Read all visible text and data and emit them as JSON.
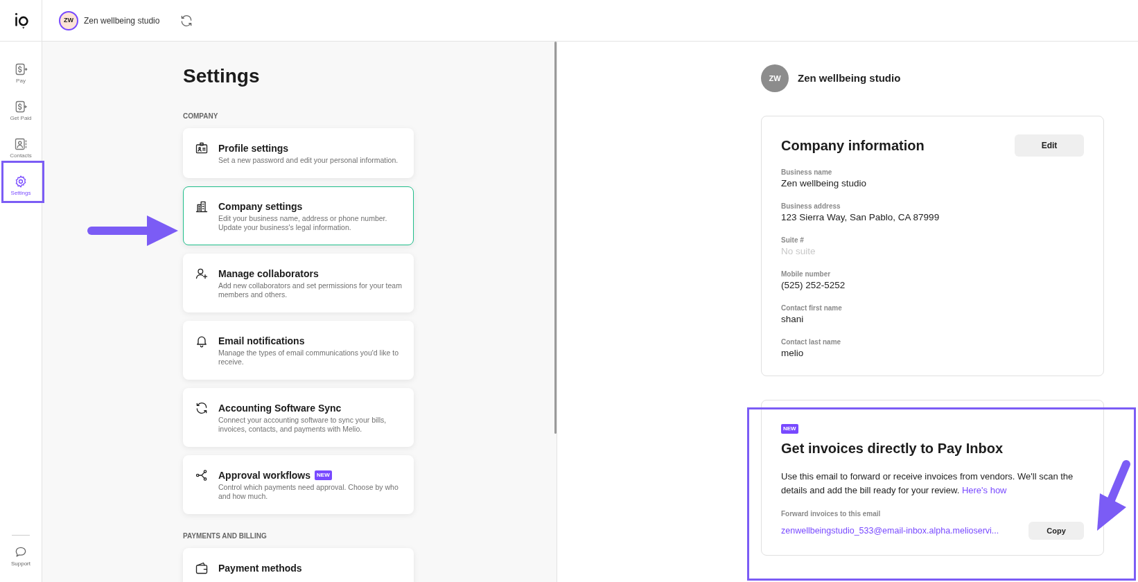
{
  "top_bar": {
    "avatar_initials": "ZW",
    "company_name": "Zen wellbeing studio"
  },
  "nav": [
    {
      "label": "Pay",
      "selected": false
    },
    {
      "label": "Get Paid",
      "selected": false
    },
    {
      "label": "Contacts",
      "selected": false
    },
    {
      "label": "Settings",
      "selected": true
    }
  ],
  "support": {
    "label": "Support"
  },
  "settings": {
    "title": "Settings",
    "sections": [
      {
        "heading": "COMPANY",
        "items": [
          {
            "title": "Profile settings",
            "description": "Set a new password and edit your personal information.",
            "selected": false
          },
          {
            "title": "Company settings",
            "description": "Edit your business name, address or phone number. Update your business's legal information.",
            "selected": true
          },
          {
            "title": "Manage collaborators",
            "description": "Add new collaborators and set permissions for your team members and others.",
            "selected": false
          },
          {
            "title": "Email notifications",
            "description": "Manage the types of email communications you'd like to receive.",
            "selected": false
          },
          {
            "title": "Accounting Software Sync",
            "description": "Connect your accounting software to sync your bills, invoices, contacts, and payments with Melio.",
            "selected": false
          },
          {
            "title": "Approval workflows",
            "badge": "NEW",
            "description": "Control which payments need approval. Choose by who and how much.",
            "selected": false
          }
        ]
      },
      {
        "heading": "PAYMENTS AND BILLING",
        "items": [
          {
            "title": "Payment methods",
            "selected": false
          }
        ]
      }
    ]
  },
  "company_header": {
    "avatar_initials": "ZW",
    "name": "Zen wellbeing studio"
  },
  "company_info": {
    "title": "Company information",
    "edit_button": "Edit",
    "fields": [
      {
        "label": "Business name",
        "value": "Zen wellbeing studio",
        "empty": false
      },
      {
        "label": "Business address",
        "value": "123 Sierra Way, San Pablo, CA 87999",
        "empty": false
      },
      {
        "label": "Suite #",
        "value": "No suite",
        "empty": true
      },
      {
        "label": "Mobile number",
        "value": "(525) 252-5252",
        "empty": false
      },
      {
        "label": "Contact first name",
        "value": "shani",
        "empty": false
      },
      {
        "label": "Contact last name",
        "value": "melio",
        "empty": false
      }
    ]
  },
  "inbox_card": {
    "badge": "NEW",
    "title": "Get invoices directly to Pay Inbox",
    "description": "Use this email to forward or receive invoices from vendors. We'll scan the details and add the bill ready for your review.",
    "link": "Here's how",
    "email_label": "Forward invoices to this email",
    "email": "zenwellbeingstudio_533@email-inbox.alpha.melioservi...",
    "copy_button": "Copy"
  }
}
